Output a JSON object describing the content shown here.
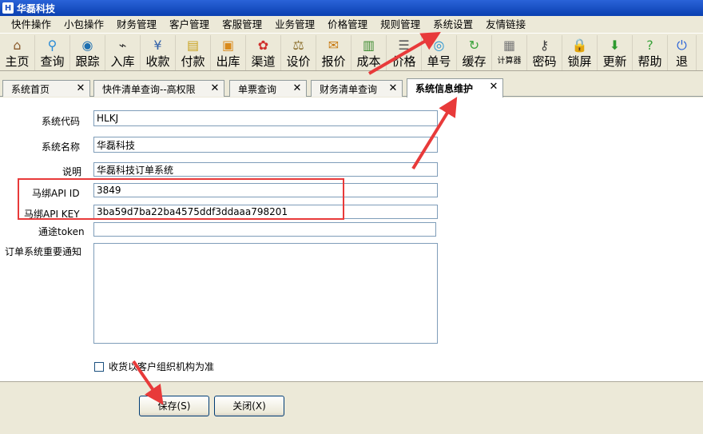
{
  "window": {
    "title": "华磊科技"
  },
  "menu": [
    "快件操作",
    "小包操作",
    "财务管理",
    "客户管理",
    "客服管理",
    "业务管理",
    "价格管理",
    "规则管理",
    "系统设置",
    "友情链接"
  ],
  "toolbar": [
    {
      "label": "主页",
      "icon": "home-icon",
      "color": "#8a5a2b",
      "glyph": "⌂"
    },
    {
      "label": "查询",
      "icon": "magnifier-icon",
      "color": "#2a8bd6",
      "glyph": "⚲"
    },
    {
      "label": "跟踪",
      "icon": "signal-icon",
      "color": "#1d6fb0",
      "glyph": "◉"
    },
    {
      "label": "入库",
      "icon": "scanner-icon",
      "color": "#333333",
      "glyph": "⌁"
    },
    {
      "label": "收款",
      "icon": "yen-icon",
      "color": "#2f5fa8",
      "glyph": "¥"
    },
    {
      "label": "付款",
      "icon": "money-icon",
      "color": "#c9a21f",
      "glyph": "▤"
    },
    {
      "label": "出库",
      "icon": "box-out-icon",
      "color": "#d98a1c",
      "glyph": "▣"
    },
    {
      "label": "渠道",
      "icon": "channel-icon",
      "color": "#d0312d",
      "glyph": "✿"
    },
    {
      "label": "设价",
      "icon": "scale-icon",
      "color": "#8a6d2a",
      "glyph": "⚖"
    },
    {
      "label": "报价",
      "icon": "price-tag-icon",
      "color": "#c87a12",
      "glyph": "✉"
    },
    {
      "label": "成本",
      "icon": "bar-chart-icon",
      "color": "#3b8a2e",
      "glyph": "▥"
    },
    {
      "label": "价格",
      "icon": "price-list-icon",
      "color": "#5a5a5a",
      "glyph": "☰"
    },
    {
      "label": "单号",
      "icon": "eye-icon",
      "color": "#1f8fd0",
      "glyph": "◎"
    },
    {
      "label": "缓存",
      "icon": "refresh-icon",
      "color": "#3aa33a",
      "glyph": "↻"
    },
    {
      "label": "计算器",
      "icon": "calculator-icon",
      "color": "#777777",
      "glyph": "▦",
      "small": true
    },
    {
      "label": "密码",
      "icon": "key-icon",
      "color": "#444444",
      "glyph": "⚷"
    },
    {
      "label": "锁屏",
      "icon": "lock-icon",
      "color": "#666666",
      "glyph": "🔒"
    },
    {
      "label": "更新",
      "icon": "download-arrow-icon",
      "color": "#2e9a2e",
      "glyph": "⬇"
    },
    {
      "label": "帮助",
      "icon": "help-icon",
      "color": "#3aa33a",
      "glyph": "?"
    },
    {
      "label": "退",
      "icon": "exit-icon",
      "color": "#2a63d8",
      "glyph": "⏻",
      "narrow": true
    }
  ],
  "tabs": [
    {
      "label": "系统首页",
      "active": false
    },
    {
      "label": "快件清单查询--高权限",
      "active": false
    },
    {
      "label": "单票查询",
      "active": false
    },
    {
      "label": "财务清单查询",
      "active": false
    },
    {
      "label": "系统信息维护",
      "active": true
    }
  ],
  "form": {
    "system_code": {
      "label": "系统代码",
      "value": "HLKJ"
    },
    "system_name": {
      "label": "系统名称",
      "value": "华磊科技"
    },
    "description": {
      "label": "说明",
      "value": "华磊科技订单系统"
    },
    "mabang_api_id": {
      "label": "马绑API ID",
      "value": "3849"
    },
    "mabang_api_key": {
      "label": "马绑API KEY",
      "value": "3ba59d7ba22ba4575ddf3ddaaa798201"
    },
    "token": {
      "label": "通途token",
      "value": ""
    },
    "notice": {
      "label": "订单系统重要通知",
      "value": ""
    },
    "checkbox_label": "收货以客户组织机构为准"
  },
  "buttons": {
    "save": "保存(S)",
    "close": "关闭(X)"
  },
  "colors": {
    "annotation": "#e83a3a"
  }
}
